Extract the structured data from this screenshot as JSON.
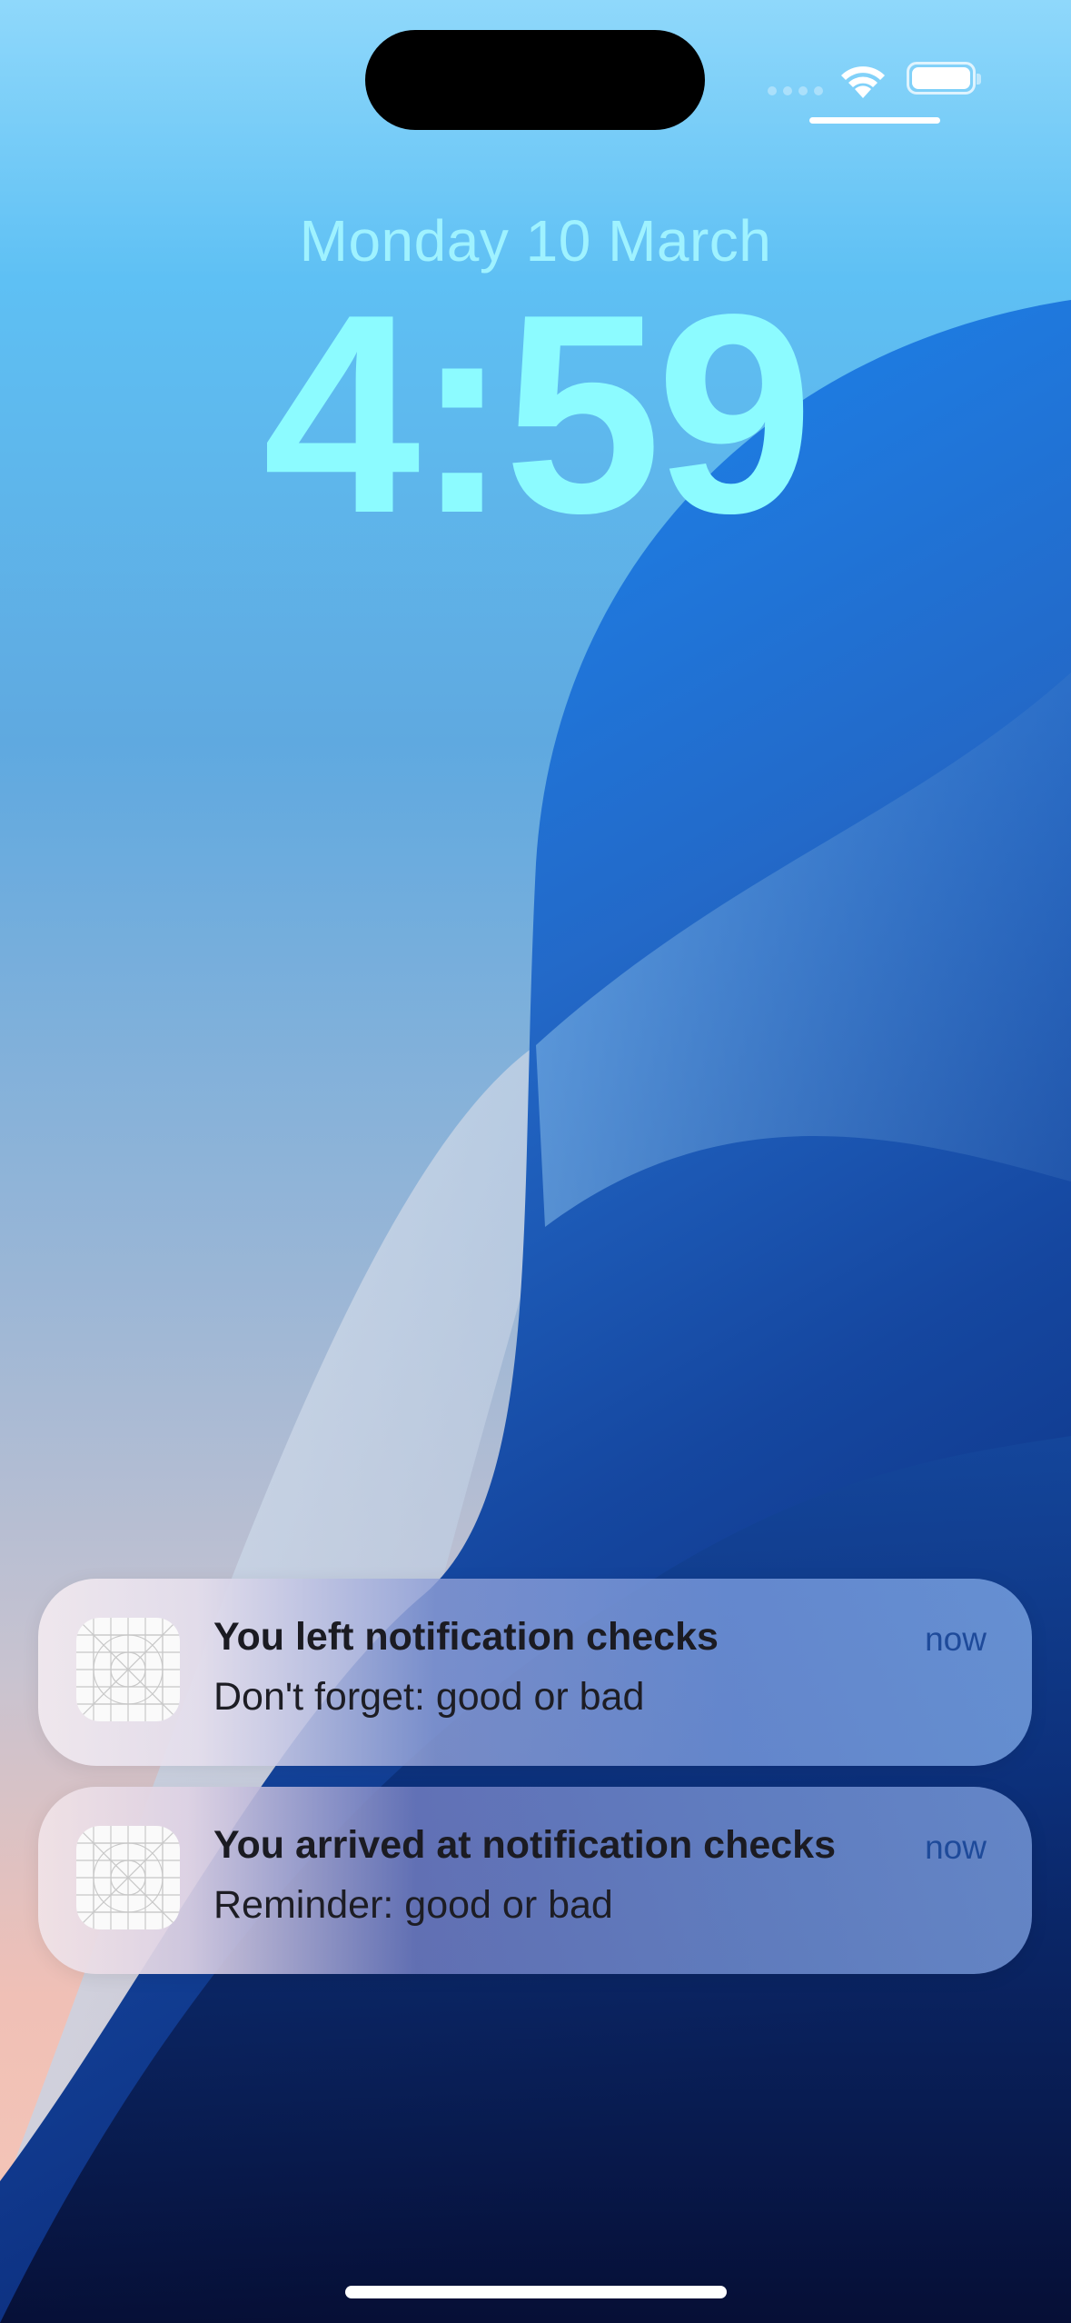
{
  "status_bar": {
    "wifi_icon": "wifi-icon",
    "battery_icon": "battery-full-icon",
    "signal_icon": "cellular-signal-icon"
  },
  "lock_screen": {
    "date": "Monday 10 March",
    "time": "4:59"
  },
  "notifications": [
    {
      "app_icon": "app-placeholder-grid-icon",
      "title": "You left notification checks",
      "body": "Don't forget: good or bad",
      "time": "now"
    },
    {
      "app_icon": "app-placeholder-grid-icon",
      "title": "You arrived at notification checks",
      "body": "Reminder: good or bad",
      "time": "now"
    }
  ],
  "colors": {
    "clock": "#8cfbff",
    "date": "#9ff2ff",
    "notification_time": "#1e4a9a"
  }
}
